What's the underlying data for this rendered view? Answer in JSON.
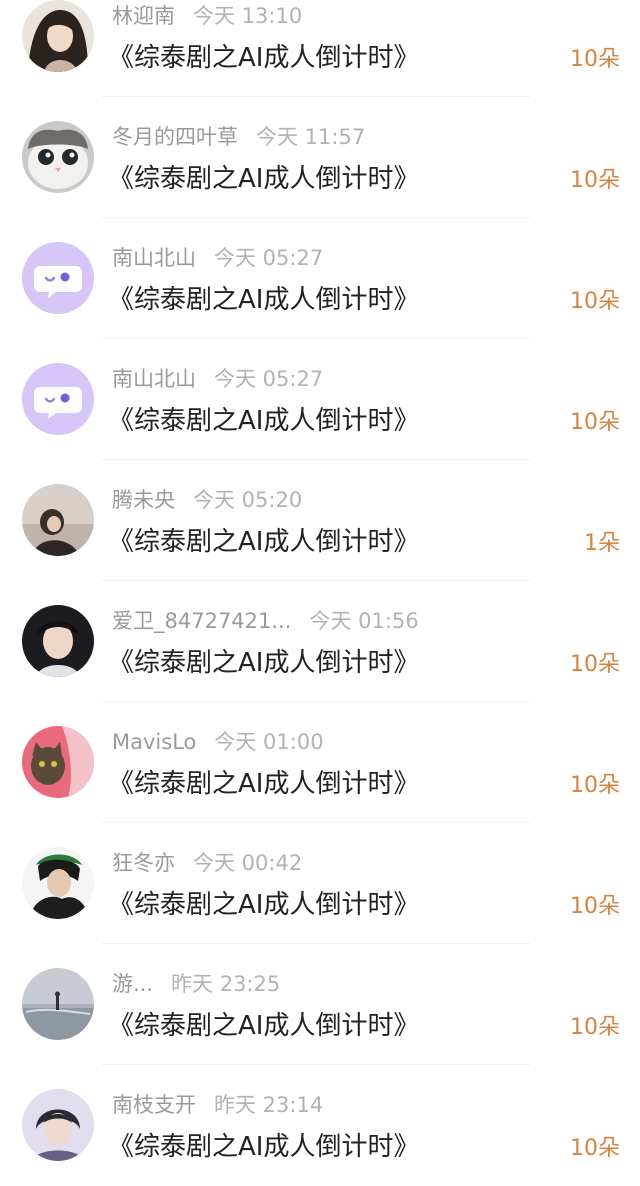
{
  "items": [
    {
      "name": "林迎南",
      "time": "今天 13:10",
      "title": "《综泰剧之AI成人倒计时》",
      "gift": "10朵",
      "avatar": "avatar-girl-illustration"
    },
    {
      "name": "冬月的四叶草",
      "time": "今天 11:57",
      "title": "《综泰剧之AI成人倒计时》",
      "gift": "10朵",
      "avatar": "avatar-kitten"
    },
    {
      "name": "南山北山",
      "time": "今天 05:27",
      "title": "《综泰剧之AI成人倒计时》",
      "gift": "10朵",
      "avatar": "avatar-default-chat"
    },
    {
      "name": "南山北山",
      "time": "今天 05:27",
      "title": "《综泰剧之AI成人倒计时》",
      "gift": "10朵",
      "avatar": "avatar-default-chat"
    },
    {
      "name": "腾未央",
      "time": "今天 05:20",
      "title": "《综泰剧之AI成人倒计时》",
      "gift": "1朵",
      "avatar": "avatar-person-dim"
    },
    {
      "name": "爱卫_84727421...",
      "time": "今天 01:56",
      "title": "《综泰剧之AI成人倒计时》",
      "gift": "10朵",
      "avatar": "avatar-young-man"
    },
    {
      "name": "MavisLo",
      "time": "今天 01:00",
      "title": "《综泰剧之AI成人倒计时》",
      "gift": "10朵",
      "avatar": "avatar-cat-red"
    },
    {
      "name": "狂冬亦",
      "time": "今天 00:42",
      "title": "《综泰剧之AI成人倒计时》",
      "gift": "10朵",
      "avatar": "avatar-anime-character"
    },
    {
      "name": "游...",
      "time": "昨天 23:25",
      "title": "《综泰剧之AI成人倒计时》",
      "gift": "10朵",
      "avatar": "avatar-seascape"
    },
    {
      "name": "南枝支开",
      "time": "昨天 23:14",
      "title": "《综泰剧之AI成人倒计时》",
      "gift": "10朵",
      "avatar": "avatar-man-portrait"
    }
  ],
  "colors": {
    "accent": "#d7833f",
    "name_text": "#9a9a9a",
    "title_text": "#222222",
    "default_avatar_bg": "#d5c6f7"
  }
}
